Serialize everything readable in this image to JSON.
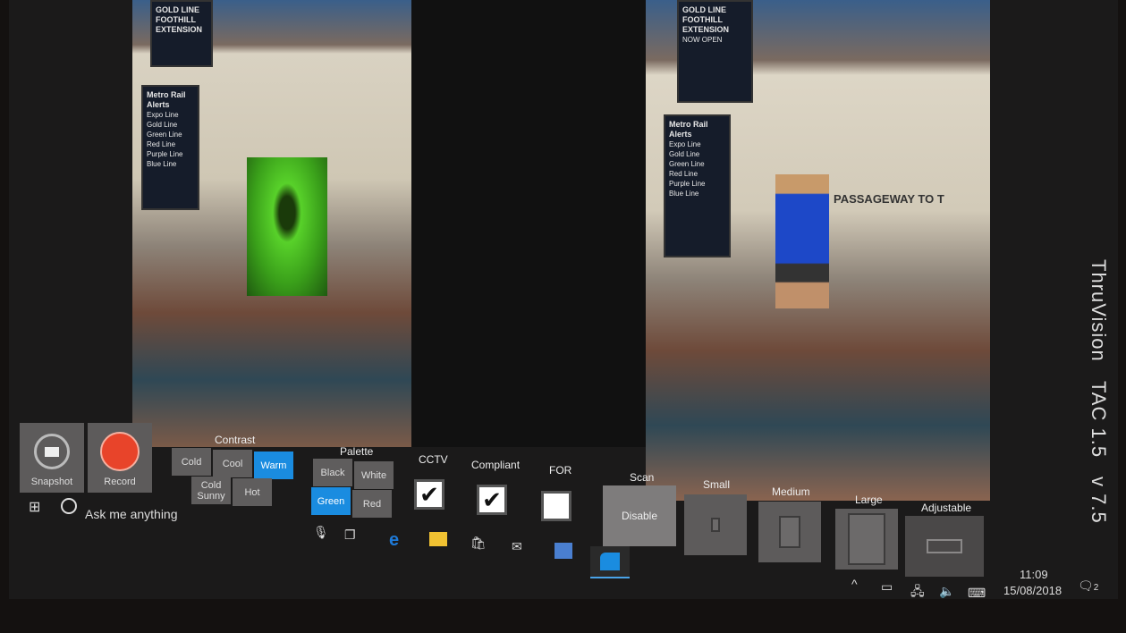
{
  "app": {
    "name": "ThruVision",
    "product": "TAC 1.5",
    "version": "v 7.5"
  },
  "left_feed": {
    "signage": {
      "title": "GOLD LINE FOOTHILL EXTENSION",
      "alerts_title": "Metro Rail Alerts",
      "lines": [
        "Expo Line",
        "Gold Line",
        "Green Line",
        "Red Line",
        "Purple Line",
        "Blue Line"
      ]
    }
  },
  "right_feed": {
    "signage": {
      "title": "GOLD LINE FOOTHILL EXTENSION",
      "subtitle": "NOW OPEN",
      "alerts_title": "Metro Rail Alerts",
      "lines": [
        "Expo Line",
        "Gold Line",
        "Green Line",
        "Red Line",
        "Purple Line",
        "Blue Line"
      ],
      "wall_text": "PASSAGEWAY TO T"
    }
  },
  "toolbar": {
    "snapshot_label": "Snapshot",
    "record_label": "Record",
    "contrast": {
      "label": "Contrast",
      "options": [
        "Cold",
        "Cool",
        "Warm",
        "Cold Sunny",
        "Hot"
      ],
      "selected": "Warm"
    },
    "palette": {
      "label": "Palette",
      "options": [
        "Black",
        "White",
        "Green",
        "Red"
      ],
      "selected": "Green"
    },
    "cctv": {
      "label": "CCTV",
      "checked": true
    },
    "compliant": {
      "label": "Compliant",
      "checked": true
    },
    "for": {
      "label": "FOR",
      "checked": false
    },
    "scan": {
      "label": "Scan",
      "button": "Disable"
    },
    "sizes": [
      "Small",
      "Medium",
      "Large",
      "Adjustable"
    ]
  },
  "taskbar": {
    "search_placeholder": "Ask me anything",
    "time": "11:09",
    "date": "15/08/2018",
    "notifications": "2"
  },
  "colors": {
    "accent": "#1a8ce0",
    "record": "#e8442a",
    "thermal": "#58d12a"
  }
}
